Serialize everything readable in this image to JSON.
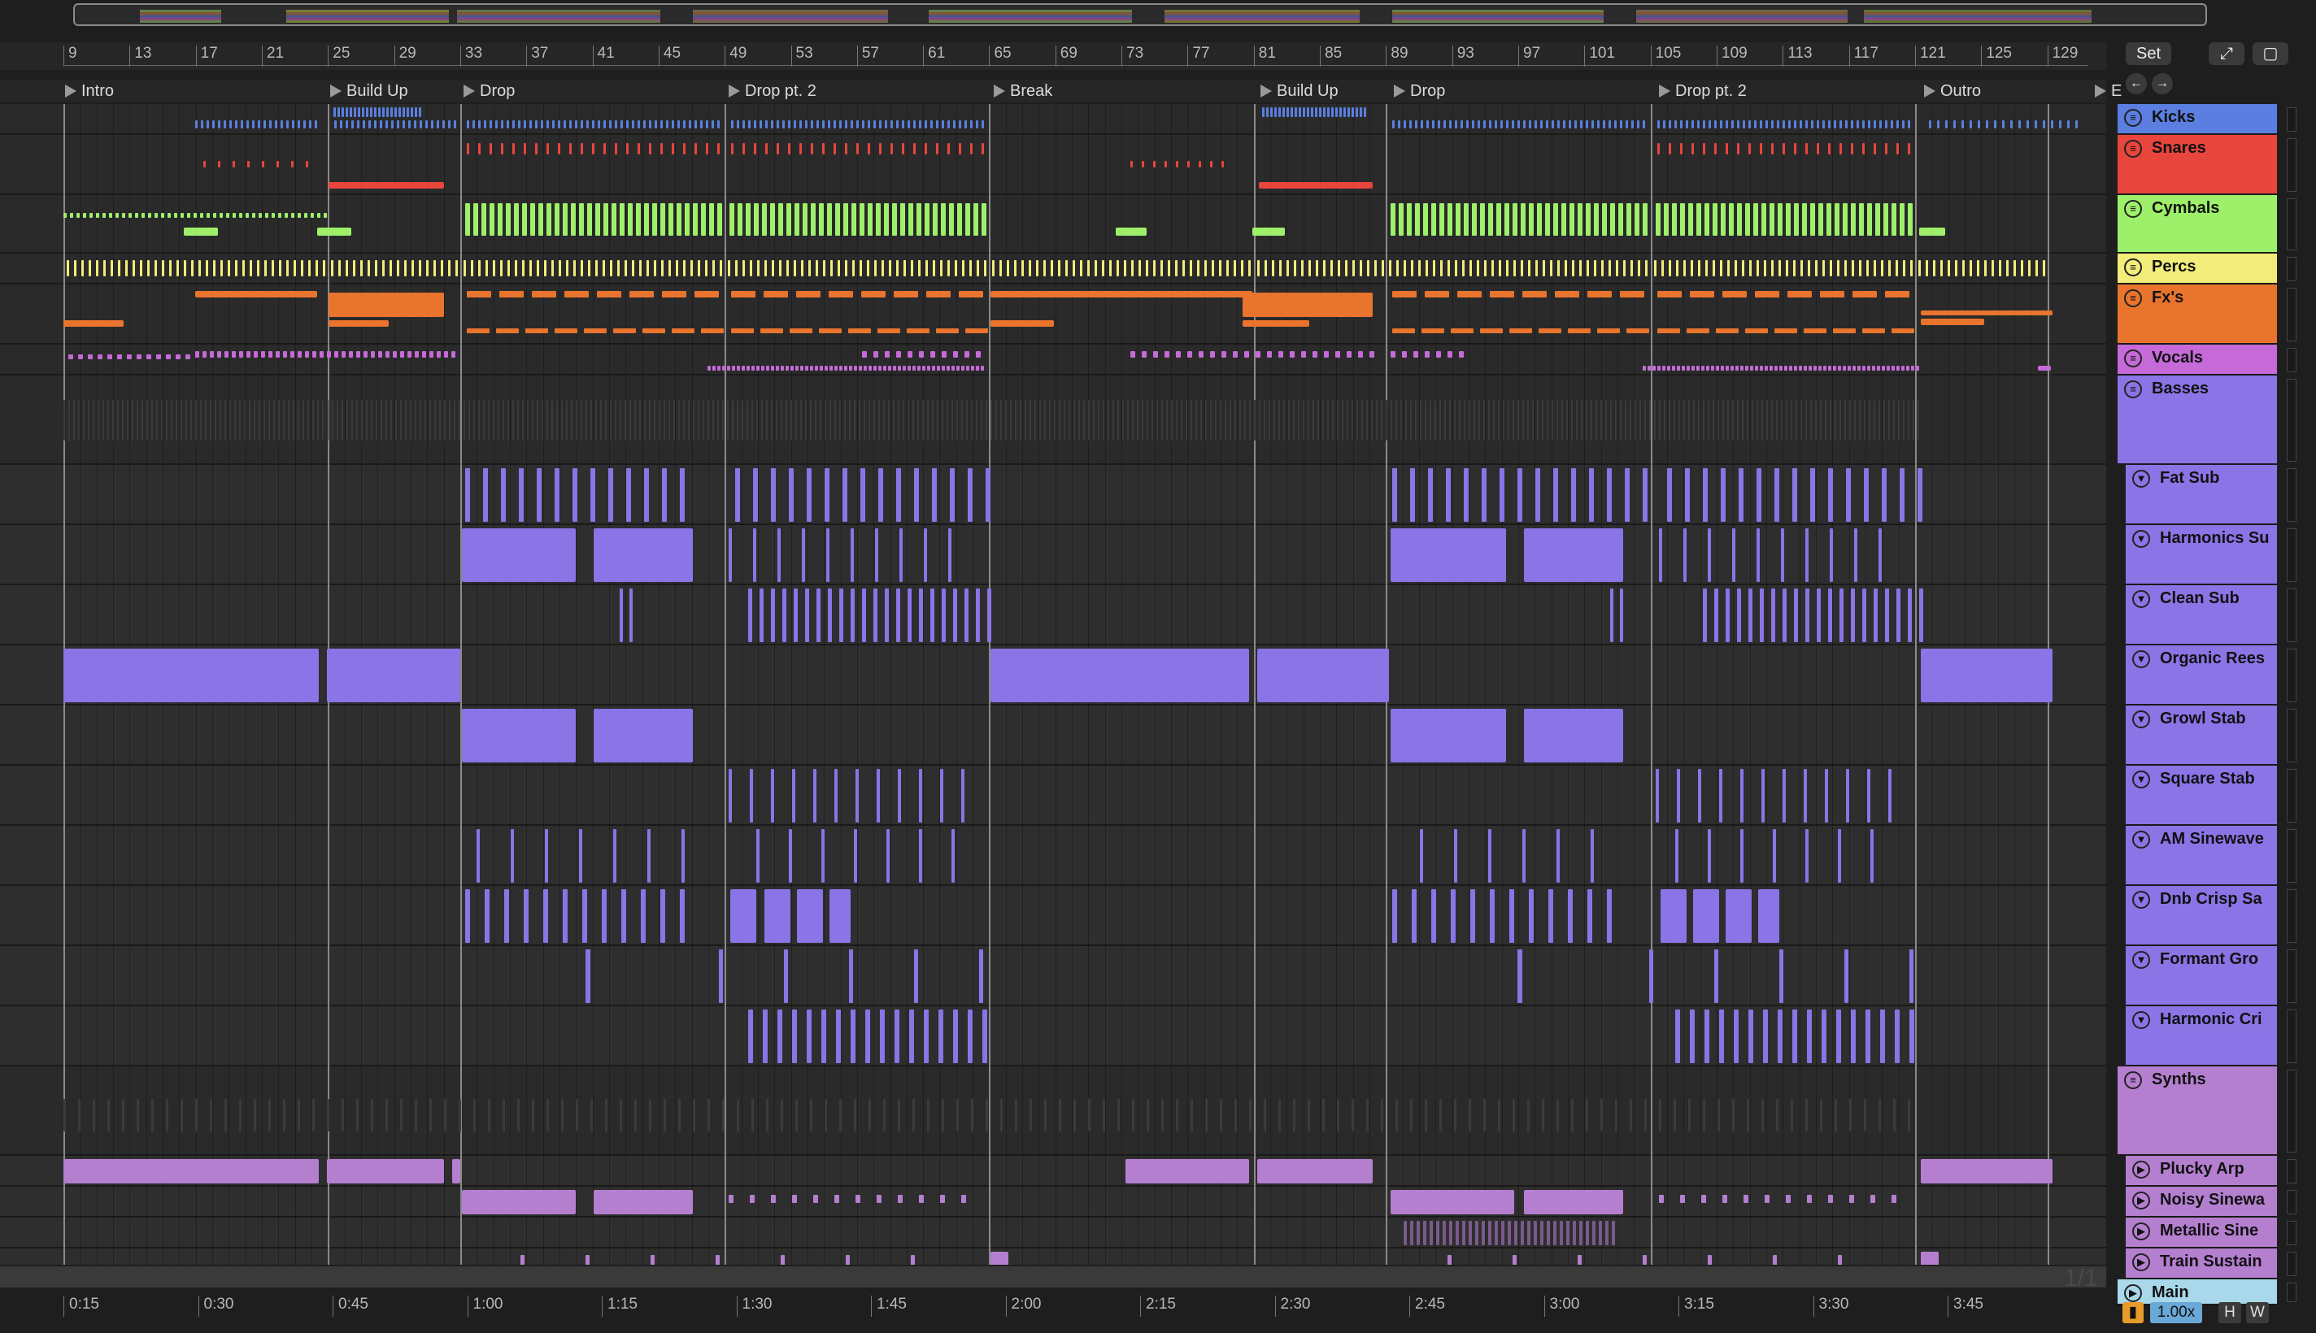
{
  "transport": {
    "set_label": "Set",
    "expand_icon": "expand-icon",
    "lock_icon": "lock-icon",
    "zoom": "1.00x",
    "h_label": "H",
    "w_label": "W",
    "page_indicator": "1/1"
  },
  "ruler": [
    "9",
    "13",
    "17",
    "21",
    "25",
    "29",
    "33",
    "37",
    "41",
    "45",
    "49",
    "53",
    "57",
    "61",
    "65",
    "69",
    "73",
    "77",
    "81",
    "85",
    "89",
    "93",
    "97",
    "101",
    "105",
    "109",
    "113",
    "117",
    "121",
    "125",
    "129"
  ],
  "time_marks": [
    "0:15",
    "0:30",
    "0:45",
    "1:00",
    "1:15",
    "1:30",
    "1:45",
    "2:00",
    "2:15",
    "2:30",
    "2:45",
    "3:00",
    "3:15",
    "3:30",
    "3:45"
  ],
  "locators": [
    "Intro",
    "Build Up",
    "Drop",
    "Drop pt. 2",
    "Break",
    "Build Up",
    "Drop",
    "Drop pt. 2",
    "Outro",
    "E"
  ],
  "tracks": [
    {
      "name": "Kicks",
      "color": "#5b7fe0"
    },
    {
      "name": "Snares",
      "color": "#e8453c"
    },
    {
      "name": "Cymbals",
      "color": "#9ef06a"
    },
    {
      "name": "Percs",
      "color": "#f2ec7a"
    },
    {
      "name": "Fx's",
      "color": "#e8742e"
    },
    {
      "name": "Vocals",
      "color": "#c56ad8"
    },
    {
      "name": "Basses",
      "color": "#8a74e6"
    },
    {
      "name": "Fat Sub",
      "color": "#8a74e6"
    },
    {
      "name": "Harmonics Su",
      "color": "#8a74e6"
    },
    {
      "name": "Clean Sub",
      "color": "#8a74e6"
    },
    {
      "name": "Organic Rees",
      "color": "#8a74e6"
    },
    {
      "name": "Growl Stab",
      "color": "#8a74e6"
    },
    {
      "name": "Square Stab",
      "color": "#8a74e6"
    },
    {
      "name": "AM Sinewave",
      "color": "#8a74e6"
    },
    {
      "name": "Dnb Crisp Sa",
      "color": "#8a74e6"
    },
    {
      "name": "Formant Gro",
      "color": "#8a74e6"
    },
    {
      "name": "Harmonic Cri",
      "color": "#8a74e6"
    },
    {
      "name": "Synths",
      "color": "#b57fd0"
    },
    {
      "name": "Plucky Arp",
      "color": "#b57fd0"
    },
    {
      "name": "Noisy Sinewa",
      "color": "#b57fd0"
    },
    {
      "name": "Metallic Sine",
      "color": "#b57fd0"
    },
    {
      "name": "Train Sustain",
      "color": "#b57fd0"
    },
    {
      "name": "Main",
      "color": "#a9d8ea"
    }
  ]
}
